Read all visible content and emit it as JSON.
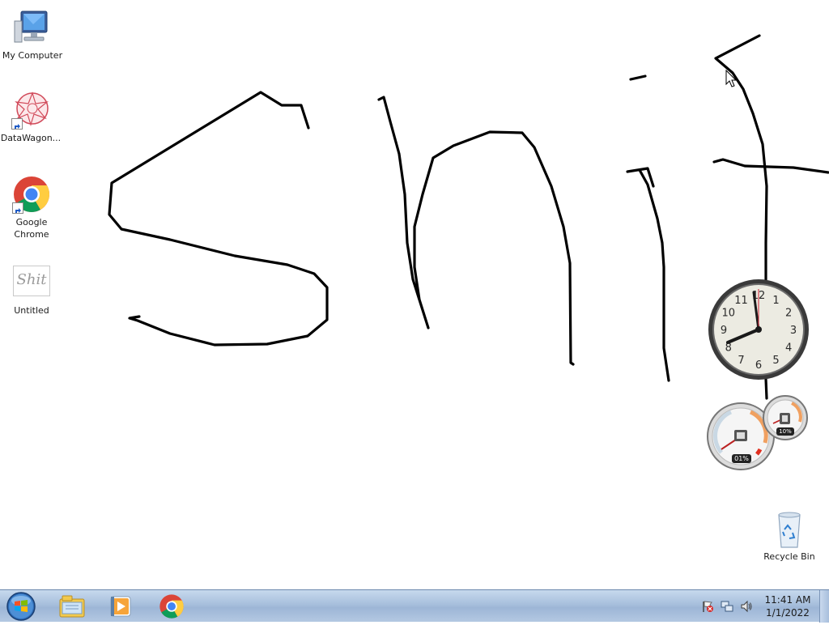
{
  "desktop": {
    "icons": [
      {
        "label": "My Computer",
        "icon": "computer-icon"
      },
      {
        "label": "DataWagon...",
        "icon": "datawagon-icon"
      },
      {
        "label": "Google Chrome",
        "icon": "chrome-icon"
      },
      {
        "label": "Untitled",
        "icon": "paint-document-icon",
        "thumb_text": "Shit"
      },
      {
        "label": "Recycle Bin",
        "icon": "recycle-bin-icon"
      }
    ],
    "drawing_text": "Shit"
  },
  "gadgets": {
    "clock": {
      "numerals": [
        "12",
        "1",
        "2",
        "3",
        "4",
        "5",
        "6",
        "7",
        "8",
        "9",
        "10",
        "11"
      ],
      "hour": 11,
      "minute": 41
    },
    "cpu_meter": {
      "cpu_percent": "01%",
      "memory_percent": "10%"
    }
  },
  "taskbar": {
    "pinned": [
      "windows-explorer-icon",
      "media-player-icon",
      "chrome-icon"
    ],
    "tray": [
      "action-center-flag-icon",
      "network-icon",
      "volume-icon"
    ],
    "clock_time": "11:41 AM",
    "clock_date": "1/1/2022"
  },
  "colors": {
    "taskbar": "#a7bfdc",
    "ink": "#000000",
    "desktop": "#ffffff"
  }
}
